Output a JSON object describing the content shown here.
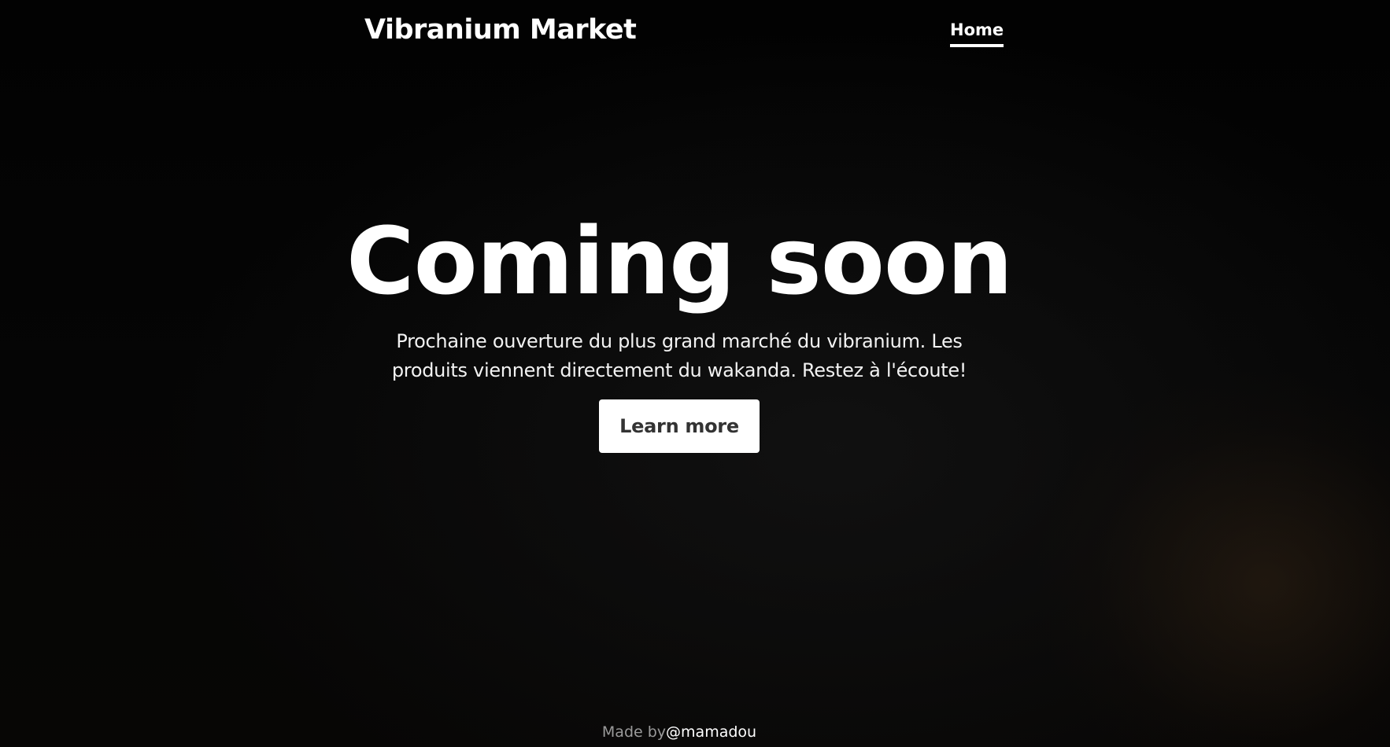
{
  "header": {
    "brand": "Vibranium Market",
    "nav": {
      "home_label": "Home"
    }
  },
  "hero": {
    "title": "Coming soon",
    "lead": "Prochaine ouverture du plus grand marché du vibranium. Les produits viennent directement du wakanda. Restez à l'écoute!",
    "cta_label": "Learn more"
  },
  "footer": {
    "made_by": "Made by",
    "author": "@mamadou"
  },
  "colors": {
    "background": "#040404",
    "text": "#ffffff",
    "button_bg": "#ffffff",
    "button_text": "#333333",
    "muted": "#9a9a9a"
  }
}
